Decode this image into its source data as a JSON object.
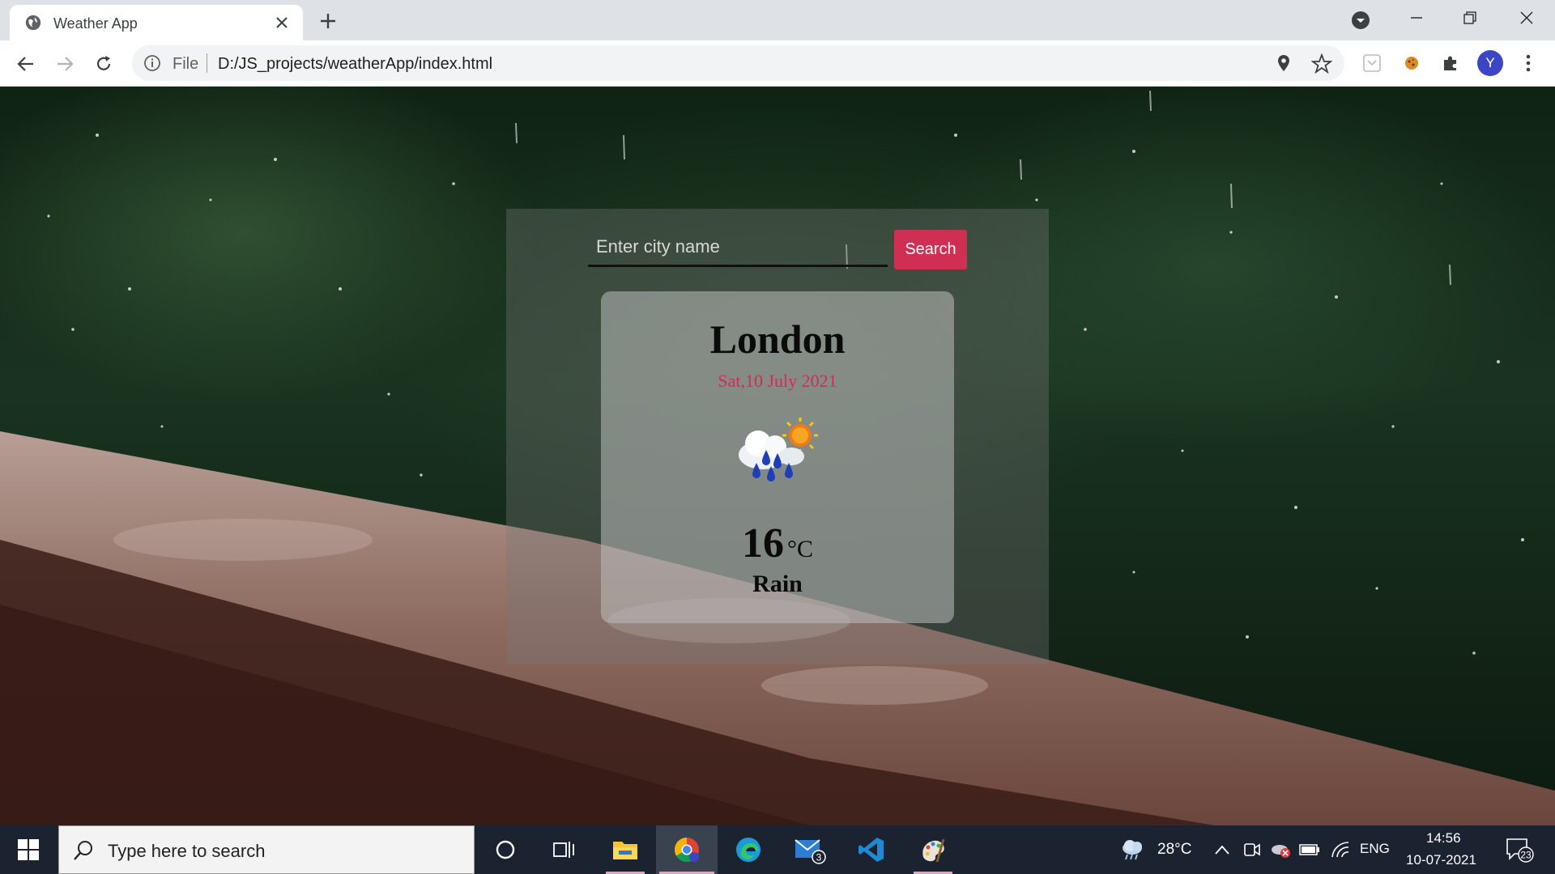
{
  "browser": {
    "tab_title": "Weather App",
    "omnibox_scheme": "File",
    "url": "D:/JS_projects/weatherApp/index.html",
    "profile_initial": "Y"
  },
  "weather": {
    "input_placeholder": "Enter city name",
    "search_label": "Search",
    "city": "London",
    "date": "Sat,10 July 2021",
    "temperature": "16",
    "unit": "°C",
    "condition": "Rain",
    "icon": "rain-sun-cloud-icon",
    "accent_color": "#d02e52"
  },
  "taskbar": {
    "search_placeholder": "Type here to search",
    "mail_badge": "3",
    "weather_temp": "28°C",
    "language": "ENG",
    "time": "14:56",
    "date": "10-07-2021",
    "notification_count": "23"
  }
}
